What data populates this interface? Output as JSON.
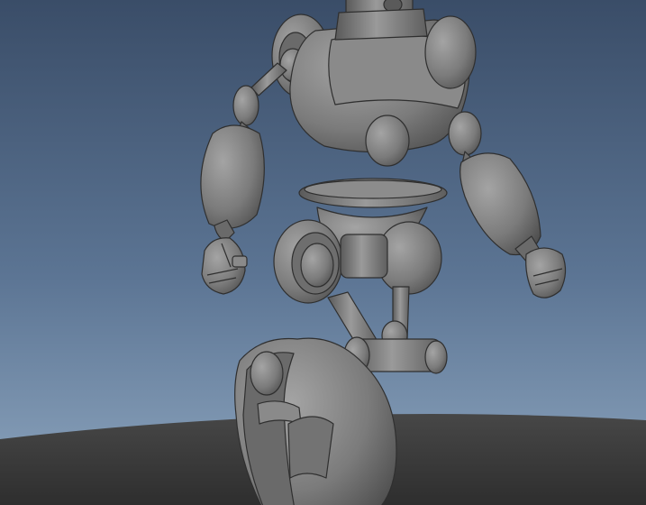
{
  "viewport": {
    "scene": "3d-viewport",
    "colors": {
      "sky_top": "#3a4d68",
      "sky_mid": "#5c7594",
      "sky_bottom": "#8ea6bf",
      "ground": "#3c3c3c",
      "model_base": "#7b7b7b",
      "model_light": "#9a9a9a",
      "model_dark": "#4e4e4e",
      "edge": "#2f2f2f"
    }
  }
}
